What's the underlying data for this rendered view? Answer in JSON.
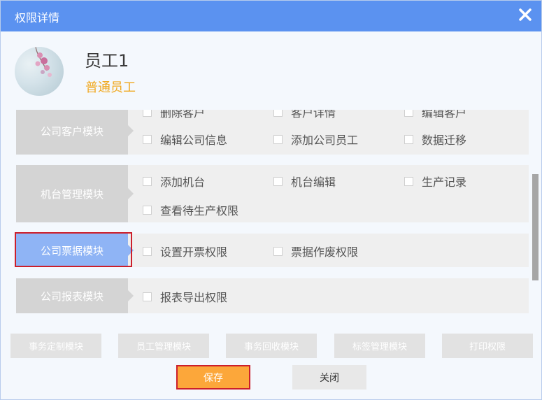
{
  "dialog": {
    "title": "权限详情"
  },
  "employee": {
    "name": "员工1",
    "role": "普通员工"
  },
  "modules": [
    {
      "label": "公司客户模块",
      "permissions": [
        "删除客户",
        "客户详情",
        "编辑客户",
        "编辑公司信息",
        "添加公司员工",
        "数据迁移"
      ]
    },
    {
      "label": "机台管理模块",
      "permissions": [
        "添加机台",
        "机台编辑",
        "生产记录",
        "查看待生产权限"
      ]
    },
    {
      "label": "公司票据模块",
      "selected": true,
      "permissions": [
        "设置开票权限",
        "票据作废权限"
      ]
    },
    {
      "label": "公司报表模块",
      "permissions": [
        "报表导出权限"
      ]
    }
  ],
  "bottom_tabs": [
    "事务定制模块",
    "员工管理模块",
    "事务回收模块",
    "标签管理模块",
    "打印权限"
  ],
  "buttons": {
    "save": "保存",
    "close": "关闭"
  },
  "icons": {
    "close": "close-x-icon",
    "checkbox": "checkbox-icon"
  },
  "colors": {
    "titlebar": "#5b92f0",
    "role": "#f0a81f",
    "active_module": "#8fb4f5",
    "save": "#fca73a",
    "highlight": "#cc1f2b"
  }
}
